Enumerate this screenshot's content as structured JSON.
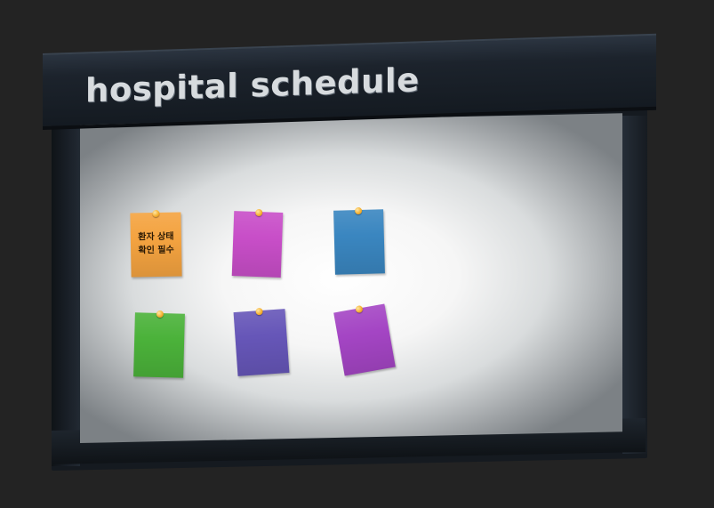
{
  "board": {
    "title": "hospital schedule"
  },
  "notes": [
    {
      "id": "orange",
      "color": "#f4a340",
      "text": "환자 상태\n확인 필수"
    },
    {
      "id": "magenta",
      "color": "#c84ec8",
      "text": ""
    },
    {
      "id": "blue",
      "color": "#3a86c0",
      "text": ""
    },
    {
      "id": "green",
      "color": "#4bb23a",
      "text": ""
    },
    {
      "id": "indigo",
      "color": "#6656b8",
      "text": ""
    },
    {
      "id": "purple",
      "color": "#a445c4",
      "text": ""
    }
  ],
  "icons": {
    "pin": "pushpin-icon"
  }
}
